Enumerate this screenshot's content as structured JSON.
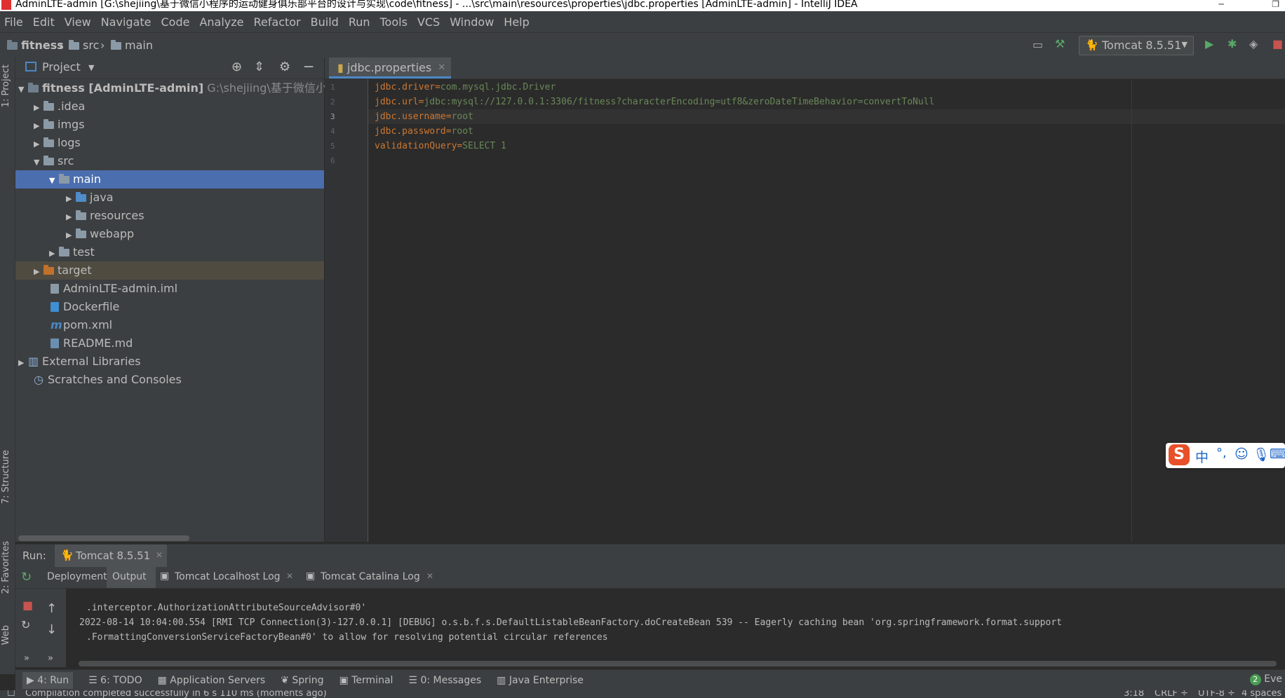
{
  "window": {
    "title": "AdminLTE-admin [G:\\shejiing\\基于微信小程序的运动健身俱乐部平台的设计与实现\\code\\fitness] - ...\\src\\main\\resources\\properties\\jdbc.properties [AdminLTE-admin] - IntelliJ IDEA"
  },
  "menu": [
    "File",
    "Edit",
    "View",
    "Navigate",
    "Code",
    "Analyze",
    "Refactor",
    "Build",
    "Run",
    "Tools",
    "VCS",
    "Window",
    "Help"
  ],
  "breadcrumb": [
    "fitness",
    "src",
    "main"
  ],
  "run_config": "Tomcat 8.5.51",
  "side_tabs": {
    "project": "1: Project",
    "structure": "7: Structure",
    "favorites": "2: Favorites",
    "web": "Web"
  },
  "project_panel": {
    "title": "Project",
    "tree": [
      {
        "label": "fitness [AdminLTE-admin]",
        "hint": "G:\\shejiing\\基于微信小程序",
        "arrow": "▼"
      },
      {
        "label": ".idea",
        "arrow": "▶"
      },
      {
        "label": "imgs",
        "arrow": "▶"
      },
      {
        "label": "logs",
        "arrow": "▶"
      },
      {
        "label": "src",
        "arrow": "▼"
      },
      {
        "label": "main",
        "arrow": "▼"
      },
      {
        "label": "java",
        "arrow": "▶"
      },
      {
        "label": "resources",
        "arrow": "▶"
      },
      {
        "label": "webapp",
        "arrow": "▶"
      },
      {
        "label": "test",
        "arrow": "▶"
      },
      {
        "label": "target",
        "arrow": "▶"
      },
      {
        "label": "AdminLTE-admin.iml",
        "arrow": ""
      },
      {
        "label": "Dockerfile",
        "arrow": ""
      },
      {
        "label": "pom.xml",
        "arrow": ""
      },
      {
        "label": "README.md",
        "arrow": ""
      },
      {
        "label": "External Libraries",
        "arrow": "▶"
      },
      {
        "label": "Scratches and Consoles",
        "arrow": ""
      }
    ]
  },
  "editor": {
    "tab": "jdbc.properties",
    "line_numbers": [
      "1",
      "2",
      "3",
      "4",
      "5",
      "6"
    ],
    "lines": [
      {
        "key": "jdbc.driver",
        "value": "com.mysql.jdbc.Driver"
      },
      {
        "key": "jdbc.url",
        "value": "jdbc:mysql://127.0.0.1:3306/fitness?characterEncoding=utf8&zeroDateTimeBehavior=convertToNull"
      },
      {
        "key": "jdbc.username",
        "value": "root"
      },
      {
        "key": "jdbc.password",
        "value": "root"
      },
      {
        "key": "validationQuery",
        "value": "SELECT 1"
      }
    ]
  },
  "run_panel": {
    "label": "Run:",
    "config_tab": "Tomcat 8.5.51",
    "tabs": [
      "Deployment",
      "Output",
      "Tomcat Localhost Log",
      "Tomcat Catalina Log"
    ],
    "console": [
      ".interceptor.AuthorizationAttributeSourceAdvisor#0'",
      "2022-08-14 10:04:00.554 [RMI TCP Connection(3)-127.0.0.1] [DEBUG] o.s.b.f.s.DefaultListableBeanFactory.doCreateBean 539 -- Eagerly caching bean 'org.springframework.format.support",
      ".FormattingConversionServiceFactoryBean#0' to allow for resolving potential circular references"
    ]
  },
  "bottom_tools": [
    "4: Run",
    "6: TODO",
    "Application Servers",
    "Spring",
    "Terminal",
    "0: Messages",
    "Java Enterprise"
  ],
  "event_log": "Eve",
  "event_count": "2",
  "status": {
    "message": "Compilation completed successfully in 6 s 110 ms (moments ago)",
    "position": "3:18",
    "line_sep": "CRLF ÷",
    "encoding": "UTF-8 ÷",
    "indent": "4 spaces"
  },
  "ime": {
    "char": "中"
  },
  "colors": {
    "key": "#cc7832",
    "value": "#6a8759",
    "selection": "#4b6eaf",
    "accent_tab": "#4a88c7"
  }
}
